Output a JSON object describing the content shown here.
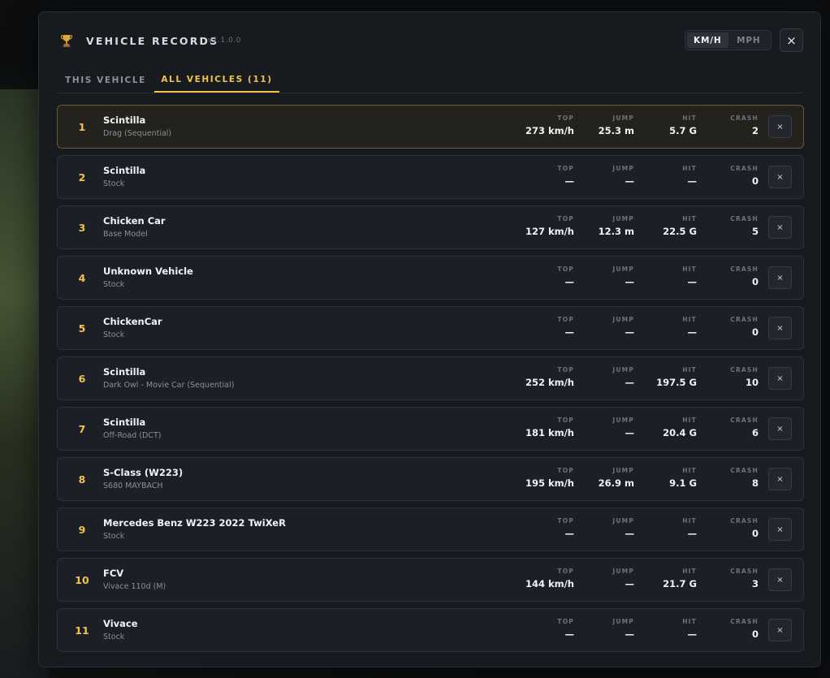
{
  "header": {
    "title": "VEHICLE RECORDS",
    "version": "v1.1.0.0",
    "units": [
      "KM/H",
      "MPH"
    ],
    "active_unit": "KM/H",
    "close_label": "×"
  },
  "tabs": [
    {
      "label": "THIS VEHICLE",
      "active": false
    },
    {
      "label": "ALL VEHICLES (11)",
      "active": true
    }
  ],
  "stat_labels": {
    "top": "TOP",
    "jump": "JUMP",
    "hit": "HIT",
    "crash": "CRASH"
  },
  "delete_label": "×",
  "colors": {
    "accent": "#f2c14e",
    "panel": "#171a1f",
    "row": "#1c2026"
  },
  "records": [
    {
      "rank": "1",
      "name": "Scintilla",
      "sub": "Drag (Sequential)",
      "top": "273 km/h",
      "jump": "25.3 m",
      "hit": "5.7 G",
      "crash": "2"
    },
    {
      "rank": "2",
      "name": "Scintilla",
      "sub": "Stock",
      "top": "—",
      "jump": "—",
      "hit": "—",
      "crash": "0"
    },
    {
      "rank": "3",
      "name": "Chicken Car",
      "sub": "Base Model",
      "top": "127 km/h",
      "jump": "12.3 m",
      "hit": "22.5 G",
      "crash": "5"
    },
    {
      "rank": "4",
      "name": "Unknown Vehicle",
      "sub": "Stock",
      "top": "—",
      "jump": "—",
      "hit": "—",
      "crash": "0"
    },
    {
      "rank": "5",
      "name": "ChickenCar",
      "sub": "Stock",
      "top": "—",
      "jump": "—",
      "hit": "—",
      "crash": "0"
    },
    {
      "rank": "6",
      "name": "Scintilla",
      "sub": "Dark Owl - Movie Car (Sequential)",
      "top": "252 km/h",
      "jump": "—",
      "hit": "197.5 G",
      "crash": "10"
    },
    {
      "rank": "7",
      "name": "Scintilla",
      "sub": "Off-Road (DCT)",
      "top": "181 km/h",
      "jump": "—",
      "hit": "20.4 G",
      "crash": "6"
    },
    {
      "rank": "8",
      "name": "S-Class (W223)",
      "sub": "S680 MAYBACH",
      "top": "195 km/h",
      "jump": "26.9 m",
      "hit": "9.1 G",
      "crash": "8"
    },
    {
      "rank": "9",
      "name": "Mercedes Benz W223 2022 TwiXeR",
      "sub": "Stock",
      "top": "—",
      "jump": "—",
      "hit": "—",
      "crash": "0"
    },
    {
      "rank": "10",
      "name": "FCV",
      "sub": "Vivace 110d (M)",
      "top": "144 km/h",
      "jump": "—",
      "hit": "21.7 G",
      "crash": "3"
    },
    {
      "rank": "11",
      "name": "Vivace",
      "sub": "Stock",
      "top": "—",
      "jump": "—",
      "hit": "—",
      "crash": "0"
    }
  ]
}
